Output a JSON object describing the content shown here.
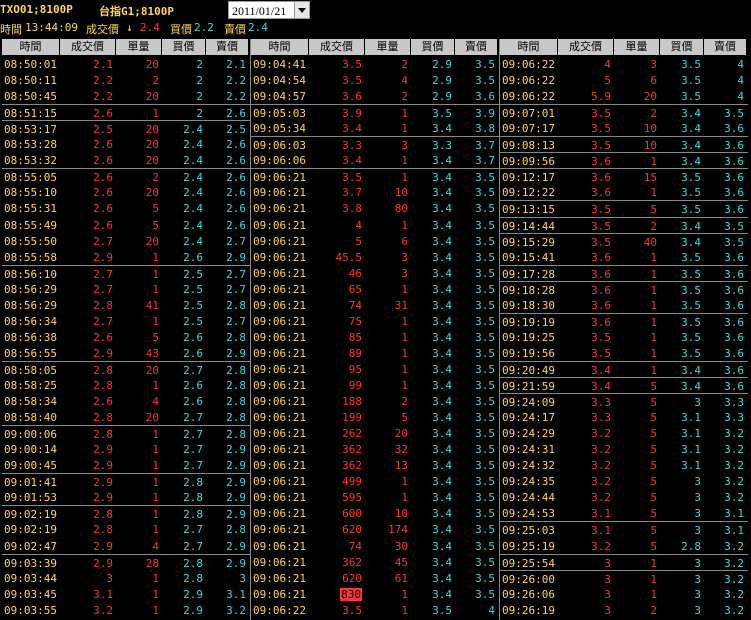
{
  "header": {
    "product1": "TXO01;8100P",
    "product2": "台指G1;8100P",
    "date": "2011/01/21",
    "time_label": "時間",
    "time": "13:44:09",
    "last_label": "成交價",
    "last_arrow": "↓",
    "last": "2.4",
    "bid_label": "買價",
    "bid": "2.2",
    "ask_label": "賣價",
    "ask": "2.4"
  },
  "columns": [
    "時間",
    "成交價",
    "單量",
    "買價",
    "賣價"
  ],
  "panels": [
    {
      "rows": [
        {
          "t": "08:50:01",
          "p": "2.1",
          "v": "20",
          "b": "2",
          "a": "2.1",
          "sep": false
        },
        {
          "t": "08:50:11",
          "p": "2.2",
          "v": "2",
          "b": "2",
          "a": "2.2",
          "sep": false
        },
        {
          "t": "08:50:45",
          "p": "2.2",
          "v": "20",
          "b": "2",
          "a": "2.2",
          "sep": false
        },
        {
          "t": "08:51:15",
          "p": "2.6",
          "v": "1",
          "b": "2",
          "a": "2.6",
          "sep": true
        },
        {
          "t": "08:53:17",
          "p": "2.5",
          "v": "20",
          "b": "2.4",
          "a": "2.5",
          "sep": true
        },
        {
          "t": "08:53:28",
          "p": "2.6",
          "v": "20",
          "b": "2.4",
          "a": "2.6",
          "sep": false
        },
        {
          "t": "08:53:32",
          "p": "2.6",
          "v": "20",
          "b": "2.4",
          "a": "2.6",
          "sep": false
        },
        {
          "t": "08:55:05",
          "p": "2.6",
          "v": "2",
          "b": "2.4",
          "a": "2.6",
          "sep": true
        },
        {
          "t": "08:55:10",
          "p": "2.6",
          "v": "20",
          "b": "2.4",
          "a": "2.6",
          "sep": false
        },
        {
          "t": "08:55:31",
          "p": "2.6",
          "v": "5",
          "b": "2.4",
          "a": "2.6",
          "sep": false
        },
        {
          "t": "08:55:49",
          "p": "2.6",
          "v": "5",
          "b": "2.4",
          "a": "2.6",
          "sep": false
        },
        {
          "t": "08:55:50",
          "p": "2.7",
          "v": "20",
          "b": "2.4",
          "a": "2.7",
          "sep": false
        },
        {
          "t": "08:55:58",
          "p": "2.9",
          "v": "1",
          "b": "2.6",
          "a": "2.9",
          "sep": false
        },
        {
          "t": "08:56:10",
          "p": "2.7",
          "v": "1",
          "b": "2.5",
          "a": "2.7",
          "sep": true
        },
        {
          "t": "08:56:29",
          "p": "2.7",
          "v": "1",
          "b": "2.5",
          "a": "2.7",
          "sep": false
        },
        {
          "t": "08:56:29",
          "p": "2.8",
          "v": "41",
          "b": "2.5",
          "a": "2.8",
          "sep": false
        },
        {
          "t": "08:56:34",
          "p": "2.7",
          "v": "1",
          "b": "2.5",
          "a": "2.7",
          "sep": false
        },
        {
          "t": "08:56:38",
          "p": "2.6",
          "v": "5",
          "b": "2.6",
          "a": "2.8",
          "sep": false
        },
        {
          "t": "08:56:55",
          "p": "2.9",
          "v": "43",
          "b": "2.6",
          "a": "2.9",
          "sep": false
        },
        {
          "t": "08:58:05",
          "p": "2.8",
          "v": "20",
          "b": "2.7",
          "a": "2.8",
          "sep": true
        },
        {
          "t": "08:58:25",
          "p": "2.8",
          "v": "1",
          "b": "2.6",
          "a": "2.8",
          "sep": false
        },
        {
          "t": "08:58:34",
          "p": "2.6",
          "v": "4",
          "b": "2.6",
          "a": "2.8",
          "sep": false
        },
        {
          "t": "08:58:40",
          "p": "2.8",
          "v": "20",
          "b": "2.7",
          "a": "2.8",
          "sep": false
        },
        {
          "t": "09:00:06",
          "p": "2.8",
          "v": "1",
          "b": "2.7",
          "a": "2.8",
          "sep": true
        },
        {
          "t": "09:00:14",
          "p": "2.9",
          "v": "1",
          "b": "2.7",
          "a": "2.9",
          "sep": false
        },
        {
          "t": "09:00:45",
          "p": "2.9",
          "v": "1",
          "b": "2.7",
          "a": "2.9",
          "sep": false
        },
        {
          "t": "09:01:41",
          "p": "2.9",
          "v": "1",
          "b": "2.8",
          "a": "2.9",
          "sep": true
        },
        {
          "t": "09:01:53",
          "p": "2.9",
          "v": "1",
          "b": "2.8",
          "a": "2.9",
          "sep": false
        },
        {
          "t": "09:02:19",
          "p": "2.8",
          "v": "1",
          "b": "2.8",
          "a": "2.9",
          "sep": true
        },
        {
          "t": "09:02:19",
          "p": "2.8",
          "v": "1",
          "b": "2.7",
          "a": "2.8",
          "sep": false
        },
        {
          "t": "09:02:47",
          "p": "2.9",
          "v": "4",
          "b": "2.7",
          "a": "2.9",
          "sep": false
        },
        {
          "t": "09:03:39",
          "p": "2.9",
          "v": "28",
          "b": "2.8",
          "a": "2.9",
          "sep": true
        },
        {
          "t": "09:03:44",
          "p": "3",
          "v": "1",
          "b": "2.8",
          "a": "3",
          "sep": false
        },
        {
          "t": "09:03:45",
          "p": "3.1",
          "v": "1",
          "b": "2.9",
          "a": "3.1",
          "sep": false
        },
        {
          "t": "09:03:55",
          "p": "3.2",
          "v": "1",
          "b": "2.9",
          "a": "3.2",
          "sep": false
        }
      ]
    },
    {
      "rows": [
        {
          "t": "09:04:41",
          "p": "3.5",
          "v": "2",
          "b": "2.9",
          "a": "3.5",
          "sep": false
        },
        {
          "t": "09:04:54",
          "p": "3.5",
          "v": "4",
          "b": "2.9",
          "a": "3.5",
          "sep": false
        },
        {
          "t": "09:04:57",
          "p": "3.6",
          "v": "2",
          "b": "2.9",
          "a": "3.6",
          "sep": false
        },
        {
          "t": "09:05:03",
          "p": "3.9",
          "v": "1",
          "b": "3.5",
          "a": "3.9",
          "sep": true
        },
        {
          "t": "09:05:34",
          "p": "3.4",
          "v": "1",
          "b": "3.4",
          "a": "3.8",
          "sep": false
        },
        {
          "t": "09:06:03",
          "p": "3.3",
          "v": "3",
          "b": "3.3",
          "a": "3.7",
          "sep": true
        },
        {
          "t": "09:06:06",
          "p": "3.4",
          "v": "1",
          "b": "3.4",
          "a": "3.7",
          "sep": false
        },
        {
          "t": "09:06:21",
          "p": "3.5",
          "v": "1",
          "b": "3.4",
          "a": "3.5",
          "sep": true
        },
        {
          "t": "09:06:21",
          "p": "3.7",
          "v": "10",
          "b": "3.4",
          "a": "3.5",
          "sep": false
        },
        {
          "t": "09:06:21",
          "p": "3.8",
          "v": "80",
          "b": "3.4",
          "a": "3.5",
          "sep": false
        },
        {
          "t": "09:06:21",
          "p": "4",
          "v": "1",
          "b": "3.4",
          "a": "3.5",
          "sep": false
        },
        {
          "t": "09:06:21",
          "p": "5",
          "v": "6",
          "b": "3.4",
          "a": "3.5",
          "sep": false
        },
        {
          "t": "09:06:21",
          "p": "45.5",
          "v": "3",
          "b": "3.4",
          "a": "3.5",
          "sep": false
        },
        {
          "t": "09:06:21",
          "p": "46",
          "v": "3",
          "b": "3.4",
          "a": "3.5",
          "sep": false
        },
        {
          "t": "09:06:21",
          "p": "65",
          "v": "1",
          "b": "3.4",
          "a": "3.5",
          "sep": false
        },
        {
          "t": "09:06:21",
          "p": "74",
          "v": "31",
          "b": "3.4",
          "a": "3.5",
          "sep": false
        },
        {
          "t": "09:06:21",
          "p": "75",
          "v": "1",
          "b": "3.4",
          "a": "3.5",
          "sep": false
        },
        {
          "t": "09:06:21",
          "p": "85",
          "v": "1",
          "b": "3.4",
          "a": "3.5",
          "sep": false
        },
        {
          "t": "09:06:21",
          "p": "89",
          "v": "1",
          "b": "3.4",
          "a": "3.5",
          "sep": false
        },
        {
          "t": "09:06:21",
          "p": "95",
          "v": "1",
          "b": "3.4",
          "a": "3.5",
          "sep": false
        },
        {
          "t": "09:06:21",
          "p": "99",
          "v": "1",
          "b": "3.4",
          "a": "3.5",
          "sep": false
        },
        {
          "t": "09:06:21",
          "p": "188",
          "v": "2",
          "b": "3.4",
          "a": "3.5",
          "sep": false
        },
        {
          "t": "09:06:21",
          "p": "199",
          "v": "5",
          "b": "3.4",
          "a": "3.5",
          "sep": false
        },
        {
          "t": "09:06:21",
          "p": "262",
          "v": "20",
          "b": "3.4",
          "a": "3.5",
          "sep": false
        },
        {
          "t": "09:06:21",
          "p": "362",
          "v": "32",
          "b": "3.4",
          "a": "3.5",
          "sep": false
        },
        {
          "t": "09:06:21",
          "p": "362",
          "v": "13",
          "b": "3.4",
          "a": "3.5",
          "sep": false
        },
        {
          "t": "09:06:21",
          "p": "499",
          "v": "1",
          "b": "3.4",
          "a": "3.5",
          "sep": false
        },
        {
          "t": "09:06:21",
          "p": "595",
          "v": "1",
          "b": "3.4",
          "a": "3.5",
          "sep": false
        },
        {
          "t": "09:06:21",
          "p": "600",
          "v": "10",
          "b": "3.4",
          "a": "3.5",
          "sep": false
        },
        {
          "t": "09:06:21",
          "p": "620",
          "v": "174",
          "b": "3.4",
          "a": "3.5",
          "sep": false
        },
        {
          "t": "09:06:21",
          "p": "74",
          "v": "30",
          "b": "3.4",
          "a": "3.5",
          "sep": false
        },
        {
          "t": "09:06:21",
          "p": "362",
          "v": "45",
          "b": "3.4",
          "a": "3.5",
          "sep": false
        },
        {
          "t": "09:06:21",
          "p": "620",
          "v": "61",
          "b": "3.4",
          "a": "3.5",
          "sep": false
        },
        {
          "t": "09:06:21",
          "p": "830",
          "v": "1",
          "b": "3.4",
          "a": "3.5",
          "sep": false,
          "hl": true
        },
        {
          "t": "09:06:22",
          "p": "3.5",
          "v": "1",
          "b": "3.5",
          "a": "4",
          "sep": false
        }
      ]
    },
    {
      "rows": [
        {
          "t": "09:06:22",
          "p": "4",
          "v": "3",
          "b": "3.5",
          "a": "4",
          "sep": false
        },
        {
          "t": "09:06:22",
          "p": "5",
          "v": "6",
          "b": "3.5",
          "a": "4",
          "sep": false
        },
        {
          "t": "09:06:22",
          "p": "5.9",
          "v": "20",
          "b": "3.5",
          "a": "4",
          "sep": false
        },
        {
          "t": "09:07:01",
          "p": "3.5",
          "v": "2",
          "b": "3.4",
          "a": "3.5",
          "sep": true
        },
        {
          "t": "09:07:17",
          "p": "3.5",
          "v": "10",
          "b": "3.4",
          "a": "3.6",
          "sep": false
        },
        {
          "t": "09:08:13",
          "p": "3.5",
          "v": "10",
          "b": "3.4",
          "a": "3.6",
          "sep": true
        },
        {
          "t": "09:09:56",
          "p": "3.6",
          "v": "1",
          "b": "3.4",
          "a": "3.6",
          "sep": true
        },
        {
          "t": "09:12:17",
          "p": "3.6",
          "v": "15",
          "b": "3.5",
          "a": "3.6",
          "sep": true
        },
        {
          "t": "09:12:22",
          "p": "3.6",
          "v": "1",
          "b": "3.5",
          "a": "3.6",
          "sep": false
        },
        {
          "t": "09:13:15",
          "p": "3.5",
          "v": "5",
          "b": "3.5",
          "a": "3.6",
          "sep": true
        },
        {
          "t": "09:14:44",
          "p": "3.5",
          "v": "2",
          "b": "3.4",
          "a": "3.5",
          "sep": true
        },
        {
          "t": "09:15:29",
          "p": "3.5",
          "v": "40",
          "b": "3.4",
          "a": "3.5",
          "sep": true
        },
        {
          "t": "09:15:41",
          "p": "3.6",
          "v": "1",
          "b": "3.5",
          "a": "3.6",
          "sep": false
        },
        {
          "t": "09:17:28",
          "p": "3.6",
          "v": "1",
          "b": "3.5",
          "a": "3.6",
          "sep": true
        },
        {
          "t": "09:18:28",
          "p": "3.6",
          "v": "1",
          "b": "3.5",
          "a": "3.6",
          "sep": true
        },
        {
          "t": "09:18:30",
          "p": "3.6",
          "v": "1",
          "b": "3.5",
          "a": "3.6",
          "sep": false
        },
        {
          "t": "09:19:19",
          "p": "3.6",
          "v": "1",
          "b": "3.5",
          "a": "3.6",
          "sep": true
        },
        {
          "t": "09:19:25",
          "p": "3.5",
          "v": "1",
          "b": "3.5",
          "a": "3.6",
          "sep": false
        },
        {
          "t": "09:19:56",
          "p": "3.5",
          "v": "1",
          "b": "3.5",
          "a": "3.6",
          "sep": false
        },
        {
          "t": "09:20:49",
          "p": "3.4",
          "v": "1",
          "b": "3.4",
          "a": "3.6",
          "sep": true
        },
        {
          "t": "09:21:59",
          "p": "3.4",
          "v": "5",
          "b": "3.4",
          "a": "3.6",
          "sep": true
        },
        {
          "t": "09:24:09",
          "p": "3.3",
          "v": "5",
          "b": "3",
          "a": "3.3",
          "sep": true
        },
        {
          "t": "09:24:17",
          "p": "3.3",
          "v": "5",
          "b": "3.1",
          "a": "3.3",
          "sep": false
        },
        {
          "t": "09:24:29",
          "p": "3.2",
          "v": "5",
          "b": "3.1",
          "a": "3.2",
          "sep": false
        },
        {
          "t": "09:24:31",
          "p": "3.2",
          "v": "5",
          "b": "3.1",
          "a": "3.2",
          "sep": false
        },
        {
          "t": "09:24:32",
          "p": "3.2",
          "v": "5",
          "b": "3.1",
          "a": "3.2",
          "sep": false
        },
        {
          "t": "09:24:35",
          "p": "3.2",
          "v": "5",
          "b": "3",
          "a": "3.2",
          "sep": false
        },
        {
          "t": "09:24:44",
          "p": "3.2",
          "v": "5",
          "b": "3",
          "a": "3.2",
          "sep": false
        },
        {
          "t": "09:24:53",
          "p": "3.1",
          "v": "5",
          "b": "3",
          "a": "3.1",
          "sep": false
        },
        {
          "t": "09:25:03",
          "p": "3.1",
          "v": "5",
          "b": "3",
          "a": "3.1",
          "sep": true
        },
        {
          "t": "09:25:19",
          "p": "3.2",
          "v": "5",
          "b": "2.8",
          "a": "3.2",
          "sep": false
        },
        {
          "t": "09:25:54",
          "p": "3",
          "v": "1",
          "b": "3",
          "a": "3.2",
          "sep": true
        },
        {
          "t": "09:26:00",
          "p": "3",
          "v": "1",
          "b": "3",
          "a": "3.2",
          "sep": true
        },
        {
          "t": "09:26:06",
          "p": "3",
          "v": "1",
          "b": "3",
          "a": "3.2",
          "sep": false
        },
        {
          "t": "09:26:19",
          "p": "3",
          "v": "2",
          "b": "3",
          "a": "3.2",
          "sep": false
        }
      ]
    }
  ]
}
